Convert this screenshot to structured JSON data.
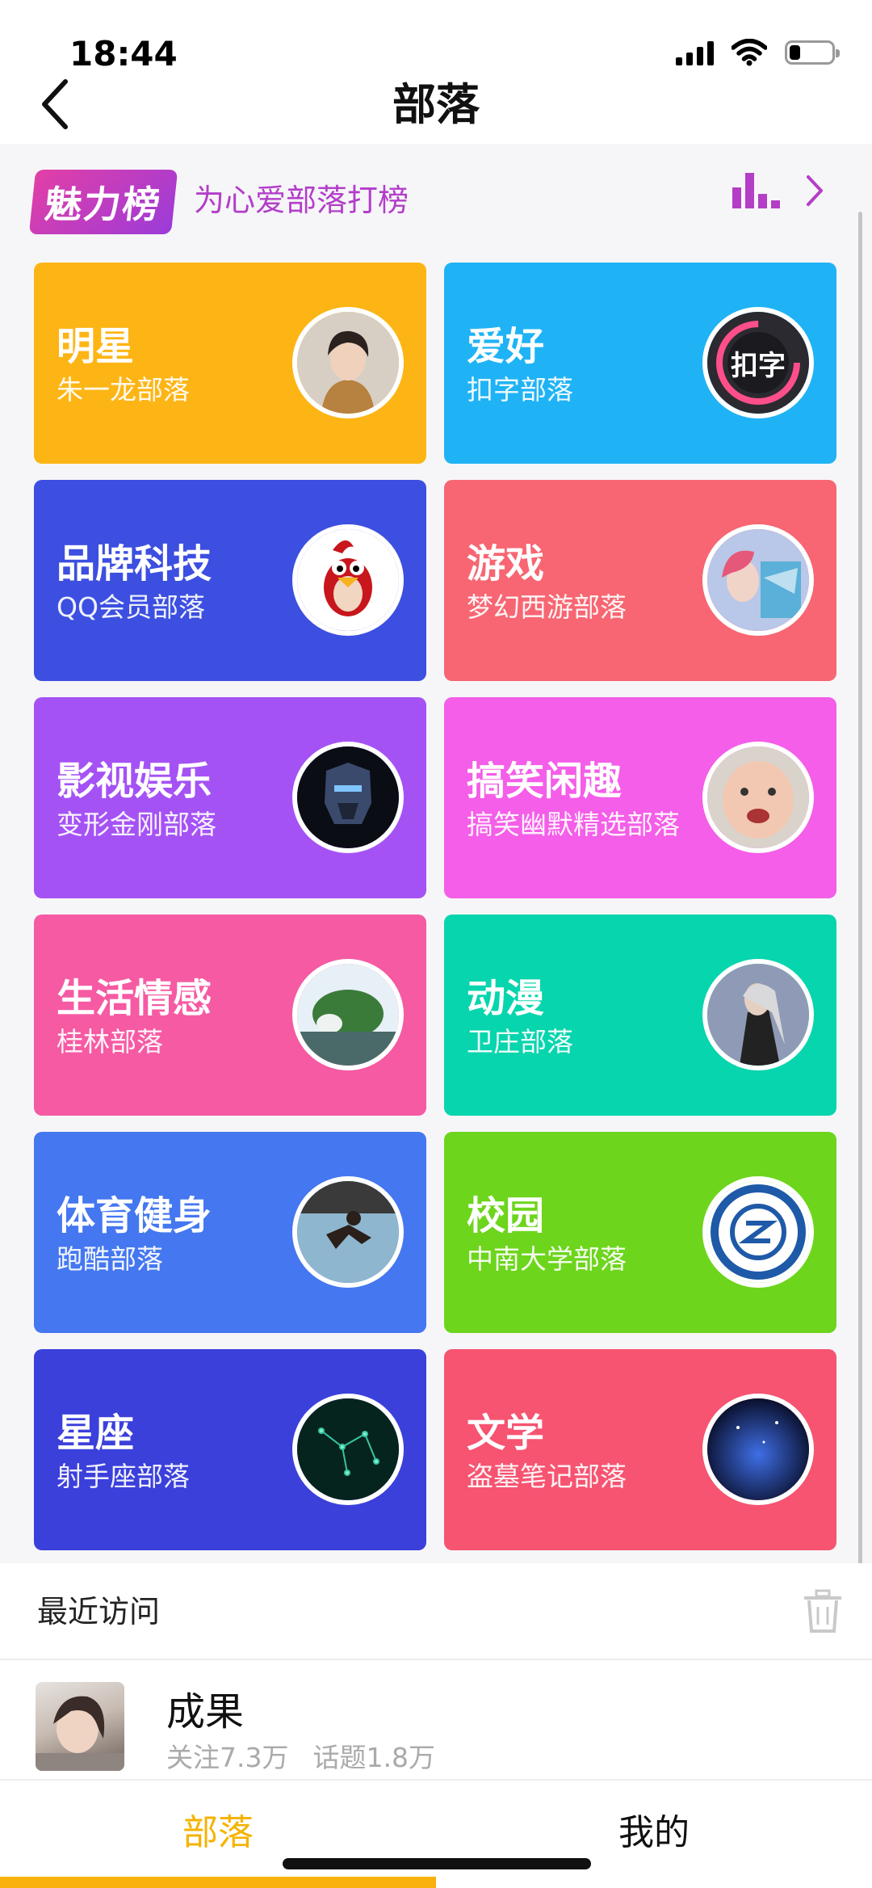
{
  "status_bar": {
    "time": "18:44",
    "battery_level": 0.25
  },
  "nav": {
    "title": "部落",
    "back_icon": "chevron-left-icon"
  },
  "charm_banner": {
    "logo_text": "魅力榜",
    "slogan": "为心爱部落打榜",
    "rank_icon": "bar-chart-icon",
    "arrow_icon": "chevron-right-icon",
    "accent_color": "#b43ec6"
  },
  "tribes": [
    {
      "category": "明星",
      "tribe": "朱一龙部落",
      "color": "#fdb515",
      "avatar_icon": "portrait-avatar-icon"
    },
    {
      "category": "爱好",
      "tribe": "扣字部落",
      "color": "#1fb3f5",
      "avatar_icon": "gauge-avatar-icon",
      "avatar_text": "扣字"
    },
    {
      "category": "品牌科技",
      "tribe": "QQ会员部落",
      "color": "#3c4fe0",
      "avatar_icon": "penguin-avatar-icon"
    },
    {
      "category": "游戏",
      "tribe": "梦幻西游部落",
      "color": "#f76672",
      "avatar_icon": "anime-game-avatar-icon"
    },
    {
      "category": "影视娱乐",
      "tribe": "变形金刚部落",
      "color": "#a552f5",
      "avatar_icon": "robot-avatar-icon"
    },
    {
      "category": "搞笑闲趣",
      "tribe": "搞笑幽默精选部落",
      "color": "#f45ee8",
      "avatar_icon": "baby-avatar-icon"
    },
    {
      "category": "生活情感",
      "tribe": "桂林部落",
      "color": "#f65aa3",
      "avatar_icon": "landscape-avatar-icon"
    },
    {
      "category": "动漫",
      "tribe": "卫庄部落",
      "color": "#07d5ad",
      "avatar_icon": "anime-avatar-icon"
    },
    {
      "category": "体育健身",
      "tribe": "跑酷部落",
      "color": "#4477f0",
      "avatar_icon": "parkour-avatar-icon"
    },
    {
      "category": "校园",
      "tribe": "中南大学部落",
      "color": "#6dd51c",
      "avatar_icon": "university-badge-avatar-icon"
    },
    {
      "category": "星座",
      "tribe": "射手座部落",
      "color": "#3b40db",
      "avatar_icon": "constellation-avatar-icon"
    },
    {
      "category": "文学",
      "tribe": "盗墓笔记部落",
      "color": "#f65471",
      "avatar_icon": "night-sky-avatar-icon"
    }
  ],
  "recent": {
    "title": "最近访问",
    "clear_icon": "trash-icon",
    "items": [
      {
        "name": "成果",
        "follow": "关注7.3万",
        "topics": "话题1.8万"
      }
    ]
  },
  "tabbar": {
    "tabs": [
      {
        "label": "部落",
        "active": true
      },
      {
        "label": "我的",
        "active": false
      }
    ],
    "active_color": "#f5b300"
  }
}
